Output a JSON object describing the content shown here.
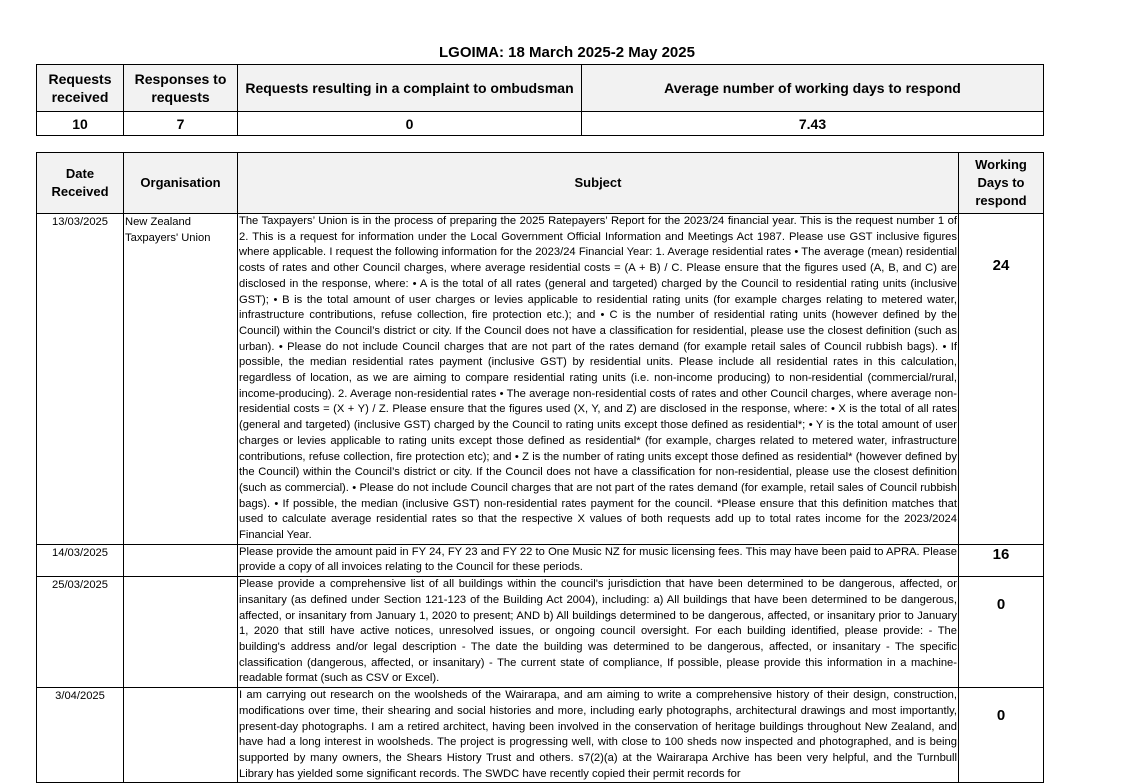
{
  "title": "LGOIMA: 18 March 2025-2 May 2025",
  "summary": {
    "headers": [
      "Requests received",
      "Responses to requests",
      "Requests resulting in a complaint to ombudsman",
      "Average number of working days to respond"
    ],
    "values": [
      "10",
      "7",
      "0",
      "7.43"
    ]
  },
  "requests": {
    "headers": [
      "Date Received",
      "Organisation",
      "Subject",
      "Working Days to respond"
    ],
    "rows": [
      {
        "date": "13/03/2025",
        "organisation": "New Zealand Taxpayers' Union",
        "subject": "The Taxpayers’ Union is in the process of preparing the 2025 Ratepayers’ Report for the 2023/24 financial year. This is the request number 1 of 2. This is a request for information under the Local Government Official Information and Meetings Act 1987. Please use GST inclusive figures where applicable. I request the following information for the 2023/24 Financial Year: 1. Average residential rates • The average (mean) residential costs of rates and other Council charges, where average residential costs = (A + B) / C. Please ensure that the figures used (A, B, and C) are disclosed in the response, where: • A is the total of all rates (general and targeted) charged by the Council to residential rating units (inclusive GST); • B is the total amount of user charges or levies applicable to residential rating units (for example charges relating to metered water, infrastructure contributions, refuse collection, fire protection etc.); and • C is the number of residential rating units (however defined by the Council) within the Council’s district or city. If the Council does not have a classification for residential, please use the closest definition (such as urban). • Please do not include Council charges that are not part of the rates demand (for example retail sales of Council rubbish bags). • If possible, the median residential rates payment (inclusive GST) by residential units. Please include all residential rates in this calculation, regardless of location, as we are aiming to compare residential rating units (i.e. non-income producing) to non-residential (commercial/rural, income-producing). 2. Average non-residential rates • The average non-residential costs of rates and other Council charges, where average non-residential costs = (X + Y) / Z. Please ensure that the figures used (X, Y, and Z) are disclosed in the response, where: • X is the total of all rates (general and targeted) (inclusive GST) charged by the Council to rating units except those defined as residential*; • Y is the total amount of user charges or levies applicable to rating units except those defined as residential* (for example, charges related to metered water, infrastructure contributions, refuse collection, fire protection etc); and • Z is the number of rating units except those defined as residential* (however defined by the Council) within the Council’s district or city. If the Council does not have a classification for non-residential, please use the closest definition (such as commercial). • Please do not include Council charges that are not part of the rates demand (for example, retail sales of Council rubbish bags). • If possible, the median (inclusive GST) non-residential rates payment for the council. *Please ensure that this definition matches that used to calculate average residential rates so that the respective X values of both requests add up to total rates income for the 2023/2024 Financial Year.",
        "days": "24"
      },
      {
        "date": "14/03/2025",
        "organisation": "",
        "subject": "Please provide the amount paid in FY 24, FY 23 and FY 22 to One Music NZ for music licensing fees.  This may have been paid to APRA. Please provide a copy of all invoices relating to the Council for these periods.",
        "days": "16"
      },
      {
        "date": "25/03/2025",
        "organisation": "",
        "subject": "Please provide a comprehensive list of all buildings within the council's jurisdiction that have been determined to be dangerous, affected, or insanitary (as defined under Section 121-123 of the Building Act 2004), including: a) All buildings that have been determined to be dangerous, affected, or insanitary from January 1, 2020 to present; AND b) All buildings determined to be dangerous, affected, or insanitary prior to January 1, 2020 that still have active notices, unresolved issues, or ongoing council oversight. For each building identified, please provide: - The building's address and/or legal description - The date the building was determined to be dangerous, affected, or insanitary - The specific classification (dangerous, affected, or insanitary) - The current state of compliance, If possible, please provide this information in a machine-readable format (such as CSV or Excel).",
        "days": "0"
      },
      {
        "date": "3/04/2025",
        "organisation": "",
        "subject": "I am carrying out research on the woolsheds of the Wairarapa, and am aiming to write a comprehensive history of their design, construction, modifications over time, their shearing and social histories and more, including early photographs, architectural drawings and most importantly, present-day photographs. I am a retired architect, having been involved in the conservation of heritage buildings throughout New Zealand, and have had a long interest in woolsheds. The project is progressing well, with close to 100 sheds now inspected and photographed, and is being supported by many owners, the Shears History Trust and others. s7(2)(a) at the Wairarapa Archive has been very helpful, and the Turnbull Library has yielded some significant records. The SWDC have recently copied their permit records for",
        "days": "0"
      }
    ]
  }
}
